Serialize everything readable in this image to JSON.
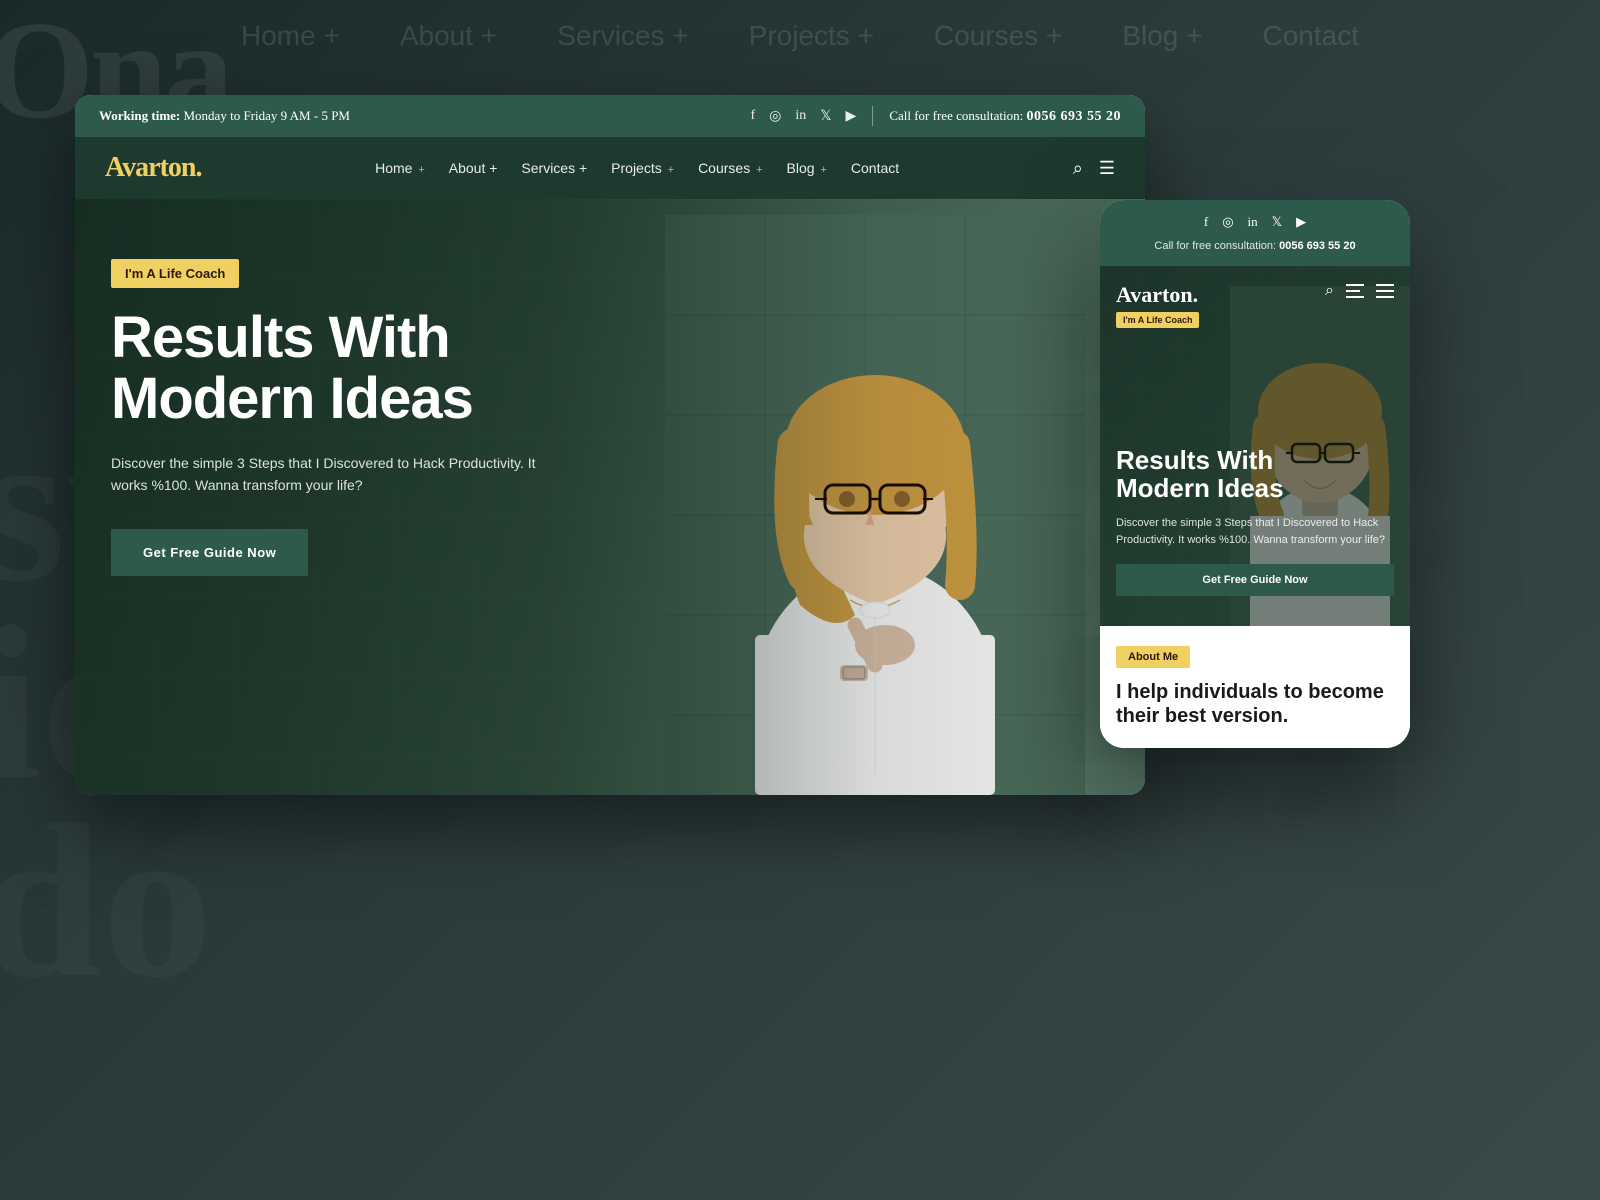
{
  "background": {
    "brand_text": "Ona.",
    "blurred_words": [
      "su",
      "id",
      "do"
    ]
  },
  "background_nav": {
    "items": [
      "Home +",
      "About +",
      "Services +",
      "Projects +",
      "Courses +",
      "Blog +",
      "Contact"
    ]
  },
  "desktop": {
    "topbar": {
      "working_time_label": "Working time:",
      "working_time_value": "Monday to Friday 9 AM - 5 PM",
      "social_icons": [
        "f",
        "ig",
        "in",
        "tw",
        "yt"
      ],
      "consultation_label": "Call for free consultation:",
      "phone": "0056 693 55 20"
    },
    "navbar": {
      "logo": "Avarton.",
      "links": [
        "Home",
        "About",
        "Services",
        "Projects",
        "Courses",
        "Blog",
        "Contact"
      ],
      "links_with_plus": [
        "Home",
        "About",
        "Services",
        "Projects",
        "Courses",
        "Blog"
      ]
    },
    "hero": {
      "badge": "I'm A Life Coach",
      "title_line1": "Results With",
      "title_line2": "Modern Ideas",
      "subtitle": "Discover the simple 3 Steps that I Discovered to Hack Productivity. It works %100. Wanna transform your life?",
      "cta": "Get Free Guide Now"
    }
  },
  "mobile": {
    "topbar": {
      "social_icons": [
        "f",
        "ig",
        "in",
        "tw",
        "yt"
      ],
      "consultation_label": "Call for free consultation:",
      "phone": "0056 693 55 20"
    },
    "logo": "Avarton.",
    "logo_badge": "I'm A Life Coach",
    "hero": {
      "title_line1": "Results With",
      "title_line2": "Modern Ideas",
      "subtitle": "Discover the simple 3 Steps that I Discovered to Hack Productivity. It works %100. Wanna transform your life?",
      "cta": "Get Free Guide Now"
    },
    "about": {
      "badge": "About Me",
      "title": "I help individuals to become their best version."
    }
  },
  "colors": {
    "dark_green": "#2d5a4a",
    "darker_green": "#1e3a2e",
    "yellow": "#f0d060",
    "text_white": "#ffffff",
    "text_dark": "#1a1a1a"
  }
}
